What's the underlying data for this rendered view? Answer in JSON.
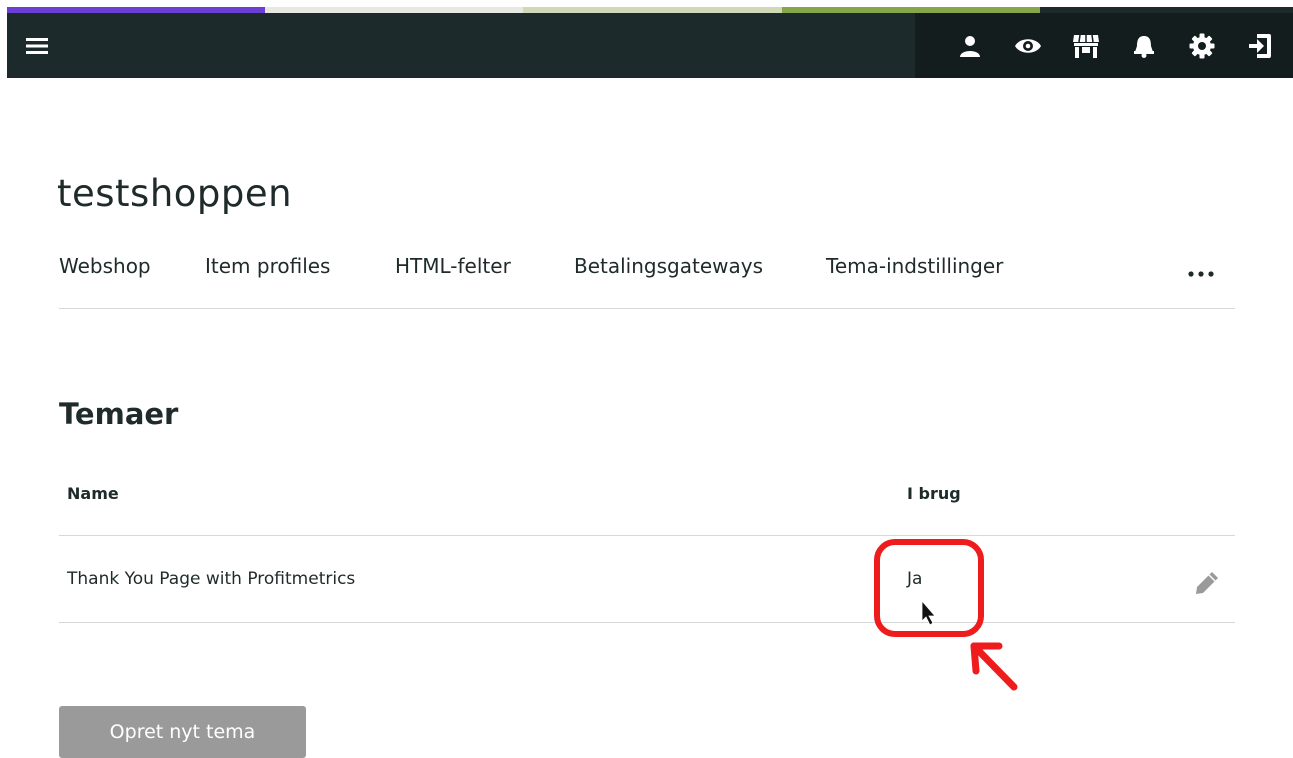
{
  "accent_colors": [
    "#6b3fd6",
    "#e8e8e3",
    "#cfd9b8",
    "#86a64a"
  ],
  "topbar": {
    "menu_icon": "hamburger-icon",
    "icons": [
      "user-icon",
      "eye-icon",
      "store-icon",
      "bell-icon",
      "gear-icon",
      "logout-icon"
    ]
  },
  "shop": {
    "title": "testshoppen"
  },
  "tabs": [
    {
      "label": "Webshop"
    },
    {
      "label": "Item profiles"
    },
    {
      "label": "HTML-felter"
    },
    {
      "label": "Betalingsgateways"
    },
    {
      "label": "Tema-indstillinger"
    }
  ],
  "tabs_more_icon": "ellipsis-icon",
  "themes": {
    "heading": "Temaer",
    "columns": {
      "name": "Name",
      "in_use": "I brug"
    },
    "rows": [
      {
        "name": "Thank You Page with Profitmetrics",
        "in_use": "Ja",
        "action_icon": "pencil-icon"
      }
    ]
  },
  "create_button": {
    "label": "Opret nyt tema"
  },
  "annotation_color": "#ee1c1c"
}
